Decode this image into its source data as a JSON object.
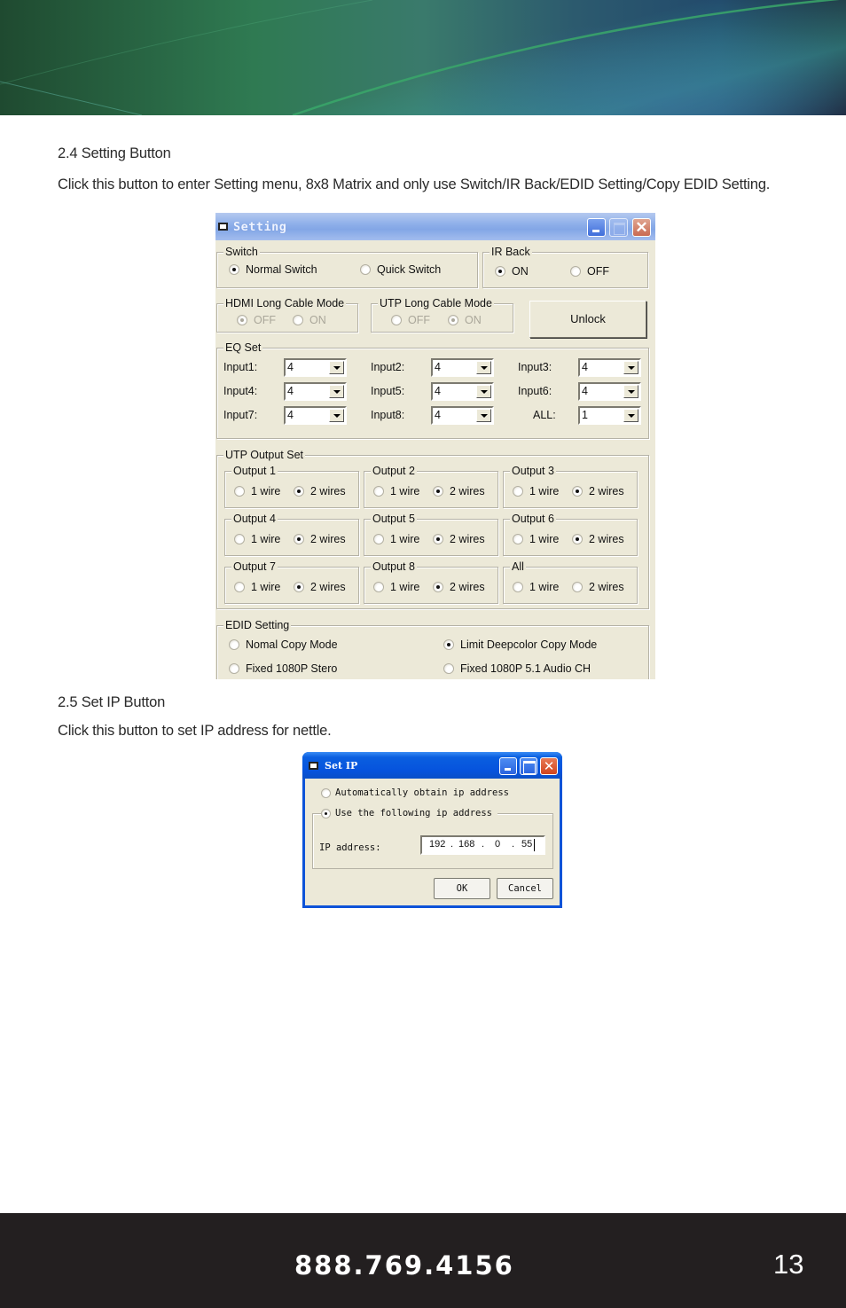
{
  "document": {
    "section_24": {
      "heading": "2.4 Setting Button",
      "body": "Click this button to enter Setting menu, 8x8 Matrix and only use Switch/IR Back/EDID Setting/Copy EDID Setting."
    },
    "section_25": {
      "heading": "2.5 Set IP Button",
      "body": "Click this button to set IP address for nettle."
    }
  },
  "setting_window": {
    "title": "Setting",
    "switch": {
      "legend": "Switch",
      "options": [
        {
          "label": "Normal Switch",
          "checked": true
        },
        {
          "label": "Quick Switch",
          "checked": false
        }
      ]
    },
    "ir_back": {
      "legend": "IR Back",
      "options": [
        {
          "label": "ON",
          "checked": true
        },
        {
          "label": "OFF",
          "checked": false
        }
      ]
    },
    "hdmi_long_cable": {
      "legend": "HDMI Long Cable Mode",
      "disabled": true,
      "options": [
        {
          "label": "OFF",
          "checked": true
        },
        {
          "label": "ON",
          "checked": false
        }
      ]
    },
    "utp_long_cable": {
      "legend": "UTP Long Cable Mode",
      "disabled": true,
      "options": [
        {
          "label": "OFF",
          "checked": false
        },
        {
          "label": "ON",
          "checked": true
        }
      ]
    },
    "unlock_label": "Unlock",
    "eq_set": {
      "legend": "EQ Set",
      "fields": [
        {
          "label": "Input1:",
          "value": "4"
        },
        {
          "label": "Input2:",
          "value": "4"
        },
        {
          "label": "Input3:",
          "value": "4"
        },
        {
          "label": "Input4:",
          "value": "4"
        },
        {
          "label": "Input5:",
          "value": "4"
        },
        {
          "label": "Input6:",
          "value": "4"
        },
        {
          "label": "Input7:",
          "value": "4"
        },
        {
          "label": "Input8:",
          "value": "4"
        },
        {
          "label": "ALL:",
          "value": "1"
        }
      ]
    },
    "utp_output_set": {
      "legend": "UTP Output Set",
      "groups": [
        {
          "legend": "Output 1",
          "one_wire": "1 wire",
          "two_wires": "2 wires",
          "selected": "2"
        },
        {
          "legend": "Output 2",
          "one_wire": "1 wire",
          "two_wires": "2 wires",
          "selected": "2"
        },
        {
          "legend": "Output 3",
          "one_wire": "1 wire",
          "two_wires": "2 wires",
          "selected": "2"
        },
        {
          "legend": "Output 4",
          "one_wire": "1 wire",
          "two_wires": "2 wires",
          "selected": "2"
        },
        {
          "legend": "Output 5",
          "one_wire": "1 wire",
          "two_wires": "2 wires",
          "selected": "2"
        },
        {
          "legend": "Output 6",
          "one_wire": "1 wire",
          "two_wires": "2 wires",
          "selected": "2"
        },
        {
          "legend": "Output 7",
          "one_wire": "1 wire",
          "two_wires": "2 wires",
          "selected": "2"
        },
        {
          "legend": "Output 8",
          "one_wire": "1 wire",
          "two_wires": "2 wires",
          "selected": "2"
        },
        {
          "legend": "All",
          "one_wire": "1 wire",
          "two_wires": "2 wires",
          "selected": "none"
        }
      ]
    },
    "edid_setting": {
      "legend": "EDID Setting",
      "options": [
        {
          "label": "Nomal Copy Mode",
          "checked": false
        },
        {
          "label": "Limit Deepcolor Copy Mode",
          "checked": true
        },
        {
          "label": "Fixed 1080P Stero",
          "checked": false
        },
        {
          "label": "Fixed 1080P 5.1 Audio CH",
          "checked": false
        }
      ]
    }
  },
  "setip_window": {
    "title": "Set IP",
    "auto_option": {
      "label": "Automatically obtain ip address",
      "checked": false
    },
    "manual_option": {
      "label": "Use the following ip address",
      "checked": true
    },
    "ip_label": "IP address:",
    "ip_octets": [
      "192",
      "168",
      "0",
      "55"
    ],
    "ok_label": "OK",
    "cancel_label": "Cancel"
  },
  "footer": {
    "phone": "888.769.4156",
    "page_number": "13"
  }
}
